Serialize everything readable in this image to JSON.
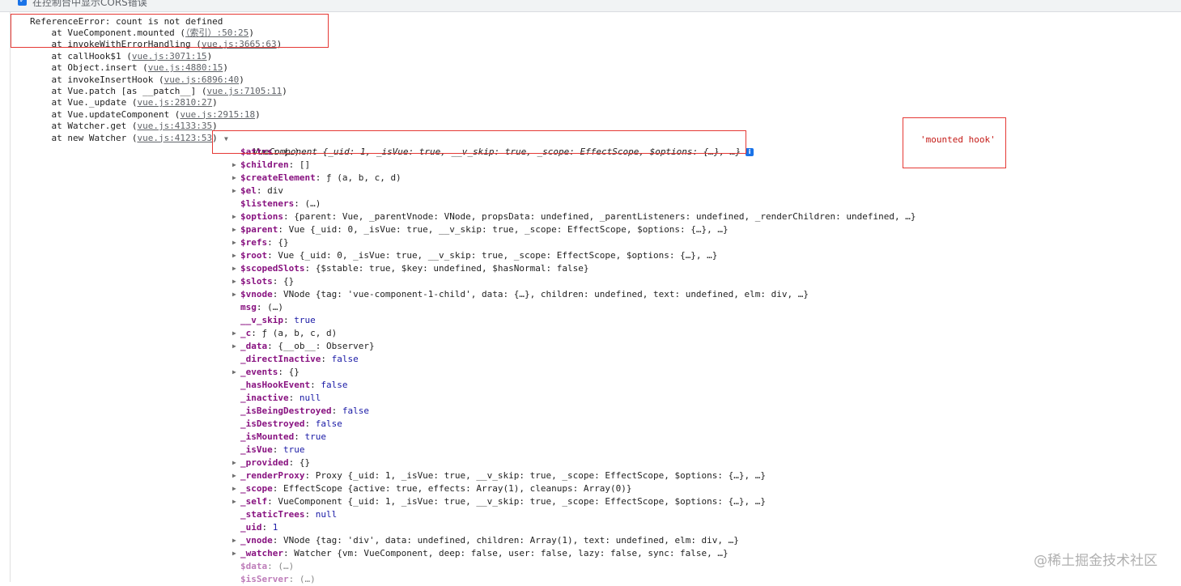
{
  "topbar": {
    "checkbox_checked": true,
    "label": "在控制台中显示CORS错误"
  },
  "error": {
    "message": "ReferenceError: count is not defined",
    "frames": [
      {
        "text": "    at VueComponent.mounted (",
        "link": "（索引）:50:25",
        "end": ")"
      },
      {
        "text": "    at invokeWithErrorHandling (",
        "link": "vue.js:3665:63",
        "end": ")"
      },
      {
        "text": "    at callHook$1 (",
        "link": "vue.js:3071:15",
        "end": ")"
      },
      {
        "text": "    at Object.insert (",
        "link": "vue.js:4880:15",
        "end": ")"
      },
      {
        "text": "    at invokeInsertHook (",
        "link": "vue.js:6896:40",
        "end": ")"
      },
      {
        "text": "    at Vue.patch [as __patch__] (",
        "link": "vue.js:7105:11",
        "end": ")"
      },
      {
        "text": "    at Vue._update (",
        "link": "vue.js:2810:27",
        "end": ")"
      },
      {
        "text": "    at Vue.updateComponent (",
        "link": "vue.js:2915:18",
        "end": ")"
      },
      {
        "text": "    at Watcher.get (",
        "link": "vue.js:4133:35",
        "end": ")"
      },
      {
        "text": "    at new Watcher (",
        "link": "vue.js:4123:53",
        "end": ")"
      }
    ]
  },
  "object": {
    "header": "VueComponent {_uid: 1, _isVue: true, __v_skip: true, _scope: EffectScope, $options: {…}, …}",
    "properties": [
      {
        "arrow": "",
        "key": "$attrs",
        "sep": ": ",
        "value": "(…)"
      },
      {
        "arrow": "▶",
        "key": "$children",
        "sep": ": ",
        "value": "[]"
      },
      {
        "arrow": "▶",
        "key": "$createElement",
        "sep": ": ",
        "value": "ƒ (a, b, c, d)"
      },
      {
        "arrow": "▶",
        "key": "$el",
        "sep": ": ",
        "value": "div"
      },
      {
        "arrow": "",
        "key": "$listeners",
        "sep": ": ",
        "value": "(…)"
      },
      {
        "arrow": "▶",
        "key": "$options",
        "sep": ": ",
        "value": "{parent: Vue, _parentVnode: VNode, propsData: undefined, _parentListeners: undefined, _renderChildren: undefined, …}"
      },
      {
        "arrow": "▶",
        "key": "$parent",
        "sep": ": ",
        "value": "Vue {_uid: 0, _isVue: true, __v_skip: true, _scope: EffectScope, $options: {…}, …}"
      },
      {
        "arrow": "▶",
        "key": "$refs",
        "sep": ": ",
        "value": "{}"
      },
      {
        "arrow": "▶",
        "key": "$root",
        "sep": ": ",
        "value": "Vue {_uid: 0, _isVue: true, __v_skip: true, _scope: EffectScope, $options: {…}, …}"
      },
      {
        "arrow": "▶",
        "key": "$scopedSlots",
        "sep": ": ",
        "value": "{$stable: true, $key: undefined, $hasNormal: false}"
      },
      {
        "arrow": "▶",
        "key": "$slots",
        "sep": ": ",
        "value": "{}"
      },
      {
        "arrow": "▶",
        "key": "$vnode",
        "sep": ": ",
        "value": "VNode {tag: 'vue-component-1-child', data: {…}, children: undefined, text: undefined, elm: div, …}"
      },
      {
        "arrow": "",
        "key": "msg",
        "sep": ": ",
        "value": "(…)"
      },
      {
        "arrow": "",
        "key": "__v_skip",
        "sep": ": ",
        "value": "true"
      },
      {
        "arrow": "▶",
        "key": "_c",
        "sep": ": ",
        "value": "ƒ (a, b, c, d)"
      },
      {
        "arrow": "▶",
        "key": "_data",
        "sep": ": ",
        "value": "{__ob__: Observer}"
      },
      {
        "arrow": "",
        "key": "_directInactive",
        "sep": ": ",
        "value": "false"
      },
      {
        "arrow": "▶",
        "key": "_events",
        "sep": ": ",
        "value": "{}"
      },
      {
        "arrow": "",
        "key": "_hasHookEvent",
        "sep": ": ",
        "value": "false"
      },
      {
        "arrow": "",
        "key": "_inactive",
        "sep": ": ",
        "value": "null"
      },
      {
        "arrow": "",
        "key": "_isBeingDestroyed",
        "sep": ": ",
        "value": "false"
      },
      {
        "arrow": "",
        "key": "_isDestroyed",
        "sep": ": ",
        "value": "false"
      },
      {
        "arrow": "",
        "key": "_isMounted",
        "sep": ": ",
        "value": "true"
      },
      {
        "arrow": "",
        "key": "_isVue",
        "sep": ": ",
        "value": "true"
      },
      {
        "arrow": "▶",
        "key": "_provided",
        "sep": ": ",
        "value": "{}"
      },
      {
        "arrow": "▶",
        "key": "_renderProxy",
        "sep": ": ",
        "value": "Proxy {_uid: 1, _isVue: true, __v_skip: true, _scope: EffectScope, $options: {…}, …}"
      },
      {
        "arrow": "▶",
        "key": "_scope",
        "sep": ": ",
        "value": "EffectScope {active: true, effects: Array(1), cleanups: Array(0)}"
      },
      {
        "arrow": "▶",
        "key": "_self",
        "sep": ": ",
        "value": "VueComponent {_uid: 1, _isVue: true, __v_skip: true, _scope: EffectScope, $options: {…}, …}"
      },
      {
        "arrow": "",
        "key": "_staticTrees",
        "sep": ": ",
        "value": "null"
      },
      {
        "arrow": "",
        "key": "_uid",
        "sep": ": ",
        "value": "1"
      },
      {
        "arrow": "▶",
        "key": "_vnode",
        "sep": ": ",
        "value": "VNode {tag: 'div', data: undefined, children: Array(1), text: undefined, elm: div, …}"
      },
      {
        "arrow": "▶",
        "key": "_watcher",
        "sep": ": ",
        "value": "Watcher {vm: VueComponent, deep: false, user: false, lazy: false, sync: false, …}"
      },
      {
        "arrow": "",
        "key": "$data",
        "sep": ": ",
        "value": "(…)",
        "faded": true
      },
      {
        "arrow": "",
        "key": "$isServer",
        "sep": ": ",
        "value": "(…)",
        "faded": true
      }
    ]
  },
  "log_string": "'mounted hook'",
  "watermark": "@稀土掘金技术社区",
  "colors": {
    "annotation_box": "#e53935",
    "key": "#881280",
    "keyword": "#1a1aa6",
    "string": "#c41a16"
  }
}
